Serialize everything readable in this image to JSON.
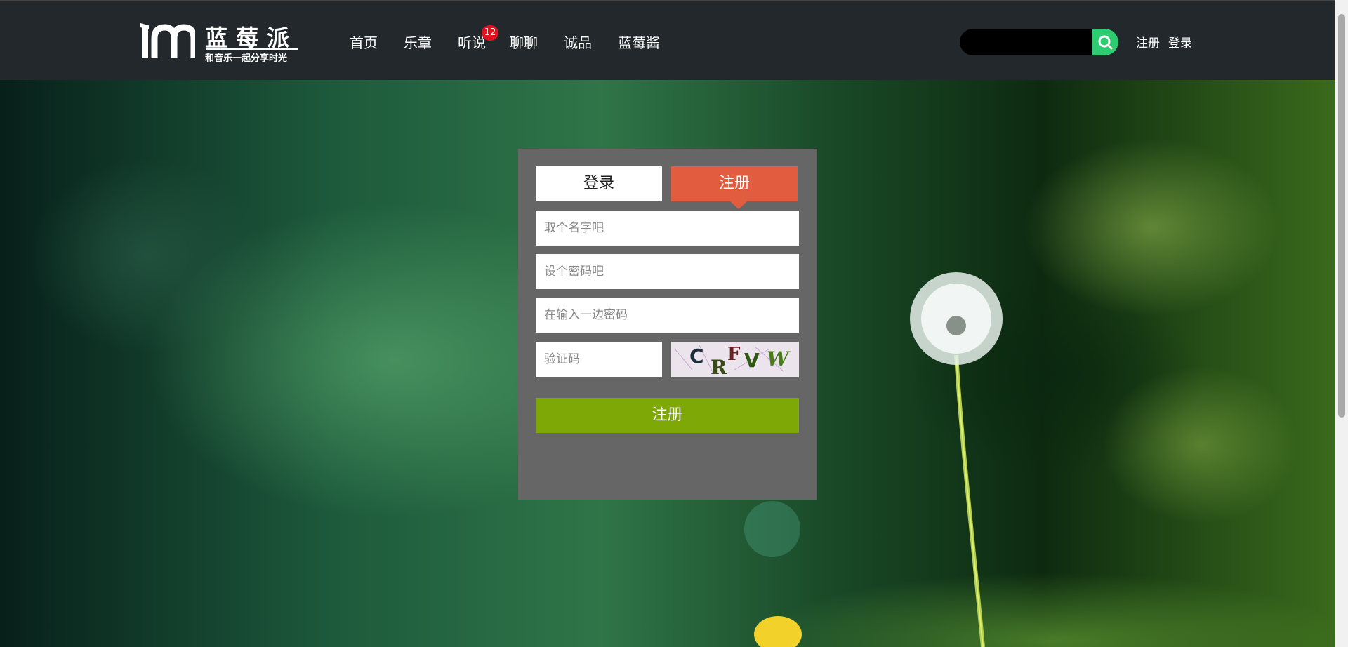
{
  "header": {
    "logo_title": "蓝莓派",
    "logo_subtitle": "和音乐一起分享时光",
    "nav": [
      {
        "label": "首页"
      },
      {
        "label": "乐章"
      },
      {
        "label": "听说",
        "badge": "12"
      },
      {
        "label": "聊聊"
      },
      {
        "label": "诚品"
      },
      {
        "label": "蓝莓酱"
      }
    ],
    "search": {
      "placeholder": "",
      "icon": "search-icon"
    },
    "register_link": "注册",
    "login_link": "登录"
  },
  "panel": {
    "tab_login": "登录",
    "tab_register": "注册",
    "active_tab": "注册",
    "username_placeholder": "取个名字吧",
    "password_placeholder": "设个密码吧",
    "confirm_placeholder": "在输入一边密码",
    "captcha_placeholder": "验证码",
    "captcha_text": [
      "C",
      "R",
      "F",
      "V",
      "W"
    ],
    "submit_label": "注册"
  },
  "colors": {
    "header_bg": "#22282c",
    "register_tab": "#e25c3f",
    "submit": "#7ea805",
    "search_button": "#2ecc71",
    "badge": "#e0141e"
  }
}
